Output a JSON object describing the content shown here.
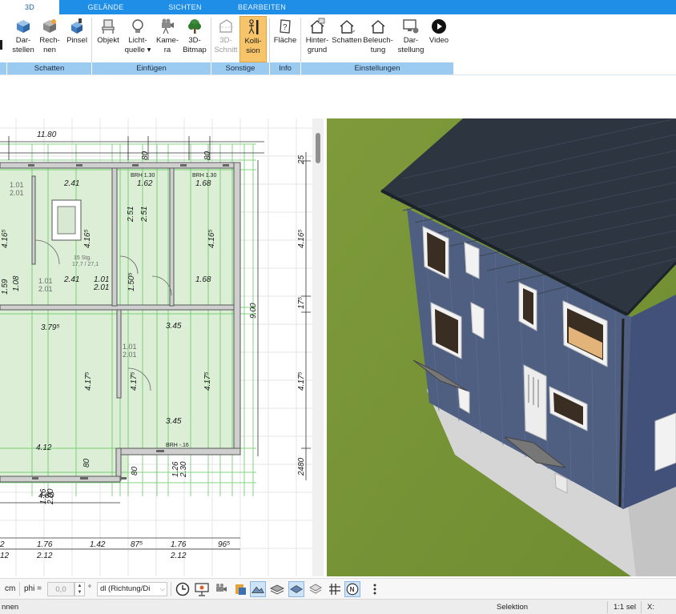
{
  "tabs": [
    {
      "label": "3D",
      "active": true
    },
    {
      "label": "GELÄNDE",
      "active": false
    },
    {
      "label": "SICHTEN",
      "active": false
    },
    {
      "label": "BEARBEITEN",
      "active": false
    }
  ],
  "ribbon": {
    "buttons": {
      "darstellen": {
        "line1": "Dar-",
        "line2": "stellen",
        "icon": "cube-icon"
      },
      "rechnen": {
        "line1": "Rech-",
        "line2": "nen",
        "icon": "render-cube-icon"
      },
      "pinsel": {
        "line1": "Pinsel",
        "line2": "",
        "icon": "paint-cube-icon"
      },
      "objekt": {
        "line1": "Objekt",
        "line2": "",
        "icon": "chair-icon"
      },
      "lichtquelle": {
        "line1": "Licht-",
        "line2": "quelle ▾",
        "icon": "lightbulb-icon"
      },
      "kamera": {
        "line1": "Kame-",
        "line2": "ra",
        "icon": "camera-icon"
      },
      "bitmap": {
        "line1": "3D-",
        "line2": "Bitmap",
        "icon": "tree-icon"
      },
      "schnitt": {
        "line1": "3D-",
        "line2": "Schnitt",
        "icon": "section-cut-icon"
      },
      "kollision": {
        "line1": "Kolli-",
        "line2": "sion",
        "icon": "collision-figure-icon"
      },
      "flaeche": {
        "line1": "Fläche",
        "line2": "",
        "icon": "area-question-icon"
      },
      "hintergrund": {
        "line1": "Hinter-",
        "line2": "grund",
        "icon": "house-background-icon"
      },
      "schatten": {
        "line1": "Schatten",
        "line2": "",
        "icon": "house-shadow-icon"
      },
      "beleuchtung": {
        "line1": "Beleuch-",
        "line2": "tung",
        "icon": "house-outline-icon"
      },
      "darstellung": {
        "line1": "Dar-",
        "line2": "stellung",
        "icon": "monitor-gear-icon"
      },
      "video": {
        "line1": "Video",
        "line2": "",
        "icon": "play-circle-icon"
      }
    },
    "groups": [
      "Schatten",
      "Einfügen",
      "Sonstige",
      "Info",
      "Einstellungen"
    ]
  },
  "plan": {
    "dims": {
      "d1180": "11.80",
      "d241": "2.41",
      "d101": "1.01",
      "d201": "2.01",
      "d162": "1.62",
      "d168": "1.68",
      "brh130a": "BRH 1.30",
      "brh130b": "BRH 1.30",
      "d80a": "80",
      "d80b": "80",
      "d416a": "4.16⁵",
      "d416b": "4.16⁵",
      "d416c": "4.16⁵",
      "d251a": "2.51",
      "d251b": "2.51",
      "stg": "15 Stg.",
      "stg2": "17,7 / 27,1",
      "d108": "1.08",
      "d101b": "1.01",
      "d201b": "2.01",
      "d241b": "2.41",
      "d101c": "1.01",
      "d201c": "2.01",
      "d150": "1.50⁵",
      "d168b": "1.68",
      "d379": "3.79⁵",
      "d345a": "3.45",
      "d101d": "1.01",
      "d201d": "2.01",
      "d417a": "4.17⁵",
      "d417b": "4.17⁵",
      "d417c": "4.17⁵",
      "d345b": "3.45",
      "d412": "4.12",
      "brh16": "BRH -.16",
      "d80c": "80",
      "d80d": "80",
      "d126": "1.26",
      "d230": "2.30",
      "d480": "4.80",
      "d116": "1.16",
      "d200": "2.00",
      "d900": "9.00",
      "d25": "25",
      "d416r": "4.16⁵",
      "d17": "17⁵",
      "d417r": "4.17⁵",
      "d2480": "2480",
      "b176a": "1.76",
      "b212a": "2.12",
      "b142": "1.42",
      "b87": "87⁵",
      "b176b": "1.76",
      "b212b": "2.12",
      "b96": "96⁵",
      "b2": "2",
      "b12": "12",
      "d159": "1.59"
    }
  },
  "toolbar": {
    "unit": "cm",
    "phi_label": "phi =",
    "phi_value": "0,0",
    "degree": "°",
    "dl_value": "dl (Richtung/Di"
  },
  "statusbar": {
    "left": "nnen",
    "mode": "Selektion",
    "scale": "1:1 sel",
    "x_label": "X:"
  }
}
